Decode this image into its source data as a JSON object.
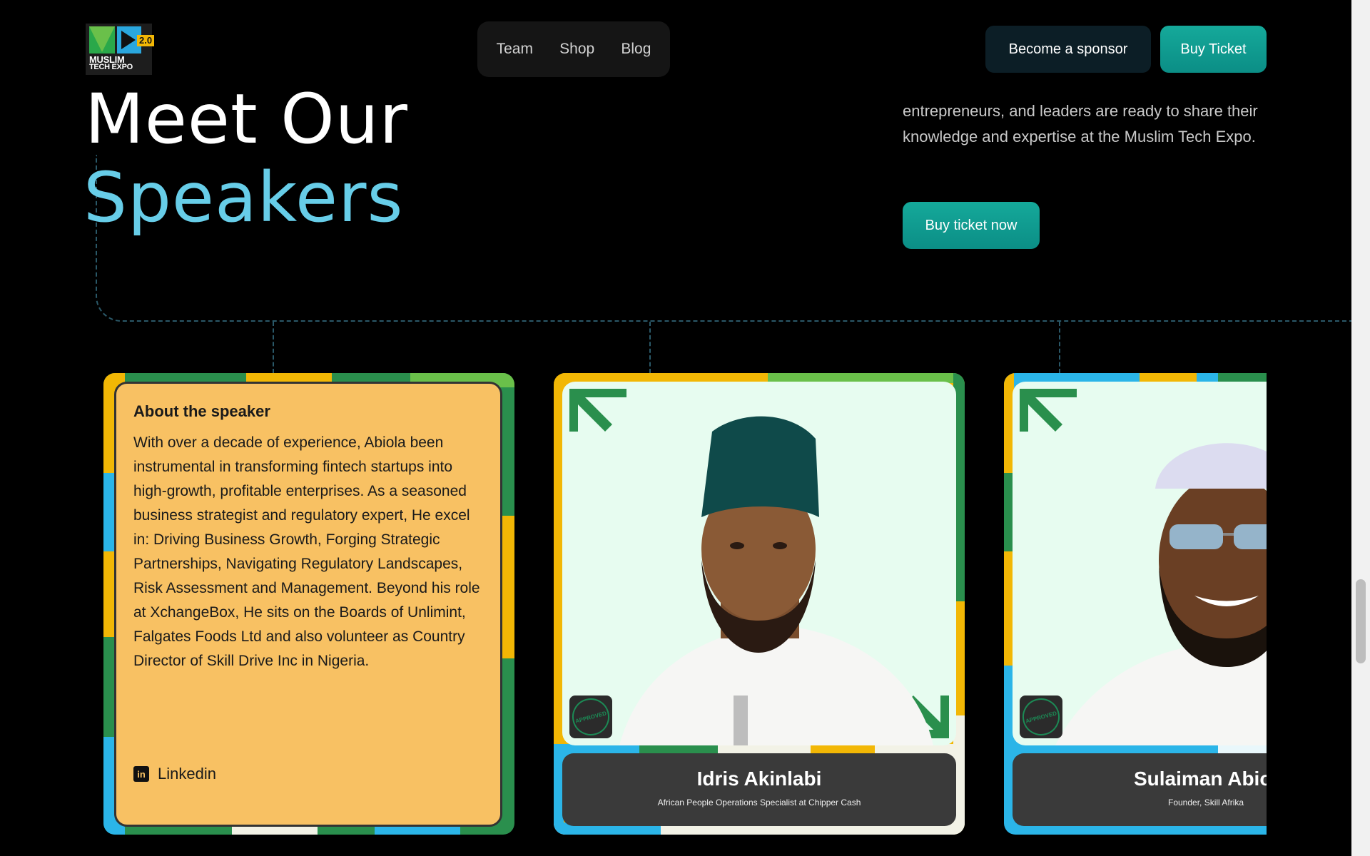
{
  "header": {
    "logo": {
      "line1": "MUSLIM",
      "line2": "TECH EXPO",
      "badge": "2.0"
    },
    "nav": [
      "Team",
      "Shop",
      "Blog"
    ],
    "sponsor_label": "Become a sponsor",
    "ticket_label": "Buy Ticket"
  },
  "hero": {
    "title_line1": "Meet Our",
    "title_line2": "Speakers",
    "intro": "entrepreneurs, and leaders are ready to share their knowledge and expertise at the Muslim Tech Expo.",
    "cta_label": "Buy ticket now"
  },
  "speakers": [
    {
      "about_heading": "About the speaker",
      "about_text": "With over a decade of experience, Abiola been instrumental in transforming fintech startups into high-growth, profitable enterprises. As a seasoned business strategist and regulatory expert, He excel in: Driving Business Growth, Forging Strategic Partnerships, Navigating Regulatory Landscapes, Risk Assessment and Management. Beyond his role at XchangeBox, He sits on the Boards of Unlimint, Falgates Foods Ltd and also volunteer as Country Director of Skill Drive Inc in Nigeria.",
      "link_label": "Linkedin"
    },
    {
      "name": "Idris Akinlabi",
      "role": "African People Operations Specialist at Chipper Cash",
      "stamp": "APPROVED"
    },
    {
      "name": "Sulaiman Abio",
      "role": "Founder, Skill Afrika",
      "stamp": "APPROVED"
    }
  ],
  "colors": {
    "accent_teal": "#0f9e90",
    "title_blue": "#67cde8",
    "card_about": "#f8c163",
    "stripe_green": "#2a8f4d",
    "stripe_yellow": "#f2b705",
    "stripe_blue": "#2bb5e8"
  }
}
